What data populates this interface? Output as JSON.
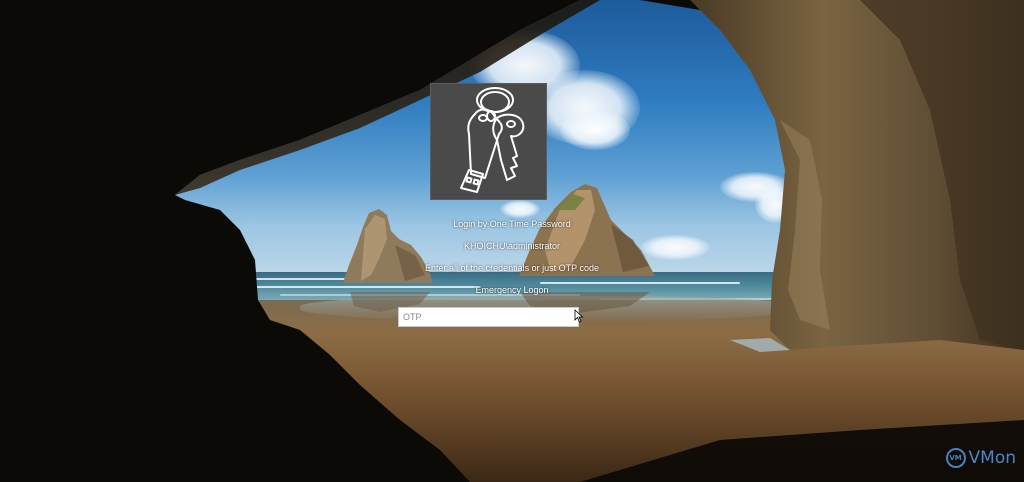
{
  "login": {
    "title": "Login by One Time Password",
    "username": "KHOICHU\\administrator",
    "hint": "Enter all of the credentials or just OTP code",
    "emergency_link": "Emergency Logon",
    "otp_placeholder": "OTP",
    "otp_value": ""
  },
  "user_tile": {
    "icon": "usb-key-icon"
  },
  "watermark": {
    "badge": "VM",
    "text": "VMon"
  },
  "colors": {
    "tile_background": "#4a4a4a",
    "text": "#ffffff",
    "watermark": "#4f86c8"
  }
}
